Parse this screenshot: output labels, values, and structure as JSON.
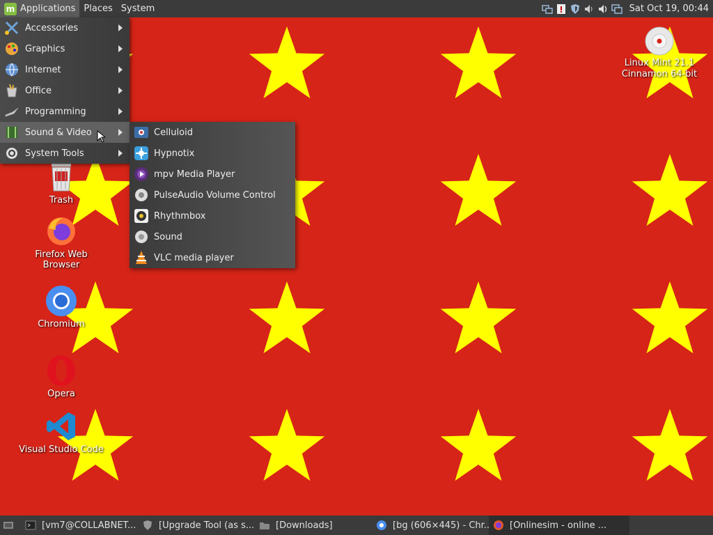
{
  "top_panel": {
    "menus": [
      "Applications",
      "Places",
      "System"
    ],
    "clock": "Sat Oct 19, 00:44",
    "tray_icons": [
      "network-icon",
      "update-manager-icon",
      "shield-icon",
      "volume-icon",
      "sound-icon",
      "network-connections-icon"
    ]
  },
  "app_menu": {
    "categories": [
      {
        "label": "Accessories",
        "icon": "accessories-icon"
      },
      {
        "label": "Graphics",
        "icon": "graphics-icon"
      },
      {
        "label": "Internet",
        "icon": "internet-icon"
      },
      {
        "label": "Office",
        "icon": "office-icon"
      },
      {
        "label": "Programming",
        "icon": "programming-icon"
      },
      {
        "label": "Sound & Video",
        "icon": "sound-video-icon",
        "selected": true
      },
      {
        "label": "System Tools",
        "icon": "system-tools-icon"
      }
    ],
    "submenu": [
      {
        "label": "Celluloid",
        "icon": "celluloid-icon"
      },
      {
        "label": "Hypnotix",
        "icon": "hypnotix-icon"
      },
      {
        "label": "mpv Media Player",
        "icon": "mpv-icon"
      },
      {
        "label": "PulseAudio Volume Control",
        "icon": "pulseaudio-icon"
      },
      {
        "label": "Rhythmbox",
        "icon": "rhythmbox-icon"
      },
      {
        "label": "Sound",
        "icon": "sound-settings-icon"
      },
      {
        "label": "VLC media player",
        "icon": "vlc-icon"
      }
    ]
  },
  "desktop_icons": [
    {
      "label": "Trash",
      "icon": "trash-icon"
    },
    {
      "label": "Firefox Web Browser",
      "icon": "firefox-icon"
    },
    {
      "label": "Chromium",
      "icon": "chromium-icon"
    },
    {
      "label": "Opera",
      "icon": "opera-icon"
    },
    {
      "label": "Visual Studio Code",
      "icon": "vscode-icon"
    },
    {
      "label": "Linux Mint 21.1",
      "label2": "Cinnamon 64-bit",
      "icon": "dvd-icon"
    }
  ],
  "taskbar": {
    "tasks": [
      {
        "label": "[vm7@COLLABNET...",
        "icon": "terminal-icon"
      },
      {
        "label": "[Upgrade Tool (as s...",
        "icon": "shield-icon"
      },
      {
        "label": "[Downloads]",
        "icon": "folder-icon"
      },
      {
        "label": "[bg (606×445) - Chr...",
        "icon": "chromium-icon"
      },
      {
        "label": "[Onlinesim - online ...",
        "icon": "firefox-icon"
      }
    ]
  },
  "colors": {
    "background": "#d62418",
    "star": "#ffff00",
    "panel": "#3b3b3b"
  }
}
